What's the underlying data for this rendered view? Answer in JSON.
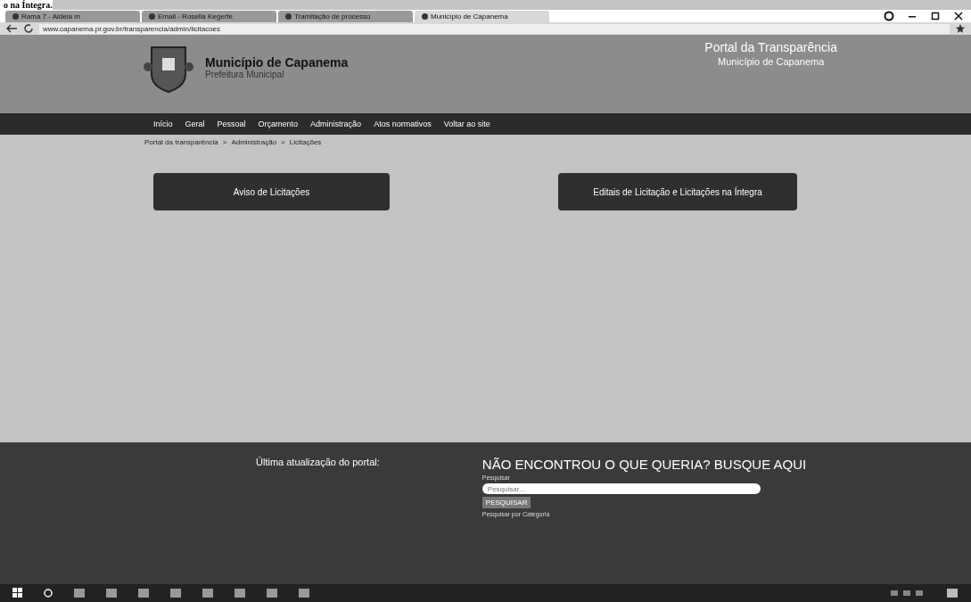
{
  "document_fragment": "o na Íntegra.",
  "browser": {
    "tabs": [
      {
        "label": "Rama 7 - Aldeia m",
        "selected": false
      },
      {
        "label": "Email - Rosella Kegerfe",
        "selected": false
      },
      {
        "label": "Tramitação de processo",
        "selected": false
      },
      {
        "label": "Município de Capanema",
        "selected": true
      }
    ],
    "url": "www.capanema.pr.gov.br/transparencia/admin/licitacoes"
  },
  "header": {
    "site_name": "Município de Capanema",
    "site_subtitle": "Prefeitura Municipal",
    "portal_title": "Portal da Transparência",
    "portal_subtitle": "Município de Capanema"
  },
  "nav": [
    "Início",
    "Geral",
    "Pessoal",
    "Orçamento",
    "Administração",
    "Atos normativos",
    "Voltar ao site"
  ],
  "breadcrumb": [
    "Portal da transparência",
    "Administração",
    "Licitações"
  ],
  "breadcrumb_separator": ">",
  "buttons": [
    "Aviso de Licitações",
    "Editais de Licitação e Licitações na Íntegra"
  ],
  "footer": {
    "last_update": "Última atualização do portal:",
    "search_heading": "NÃO ENCONTROU O QUE QUERIA? BUSQUE AQUI",
    "search_label": "Pesquisar",
    "search": {
      "placeholder": "Pesquisar..."
    },
    "search_button": "PESQUISAR",
    "category_link": "Pesquisar por Categoria"
  }
}
